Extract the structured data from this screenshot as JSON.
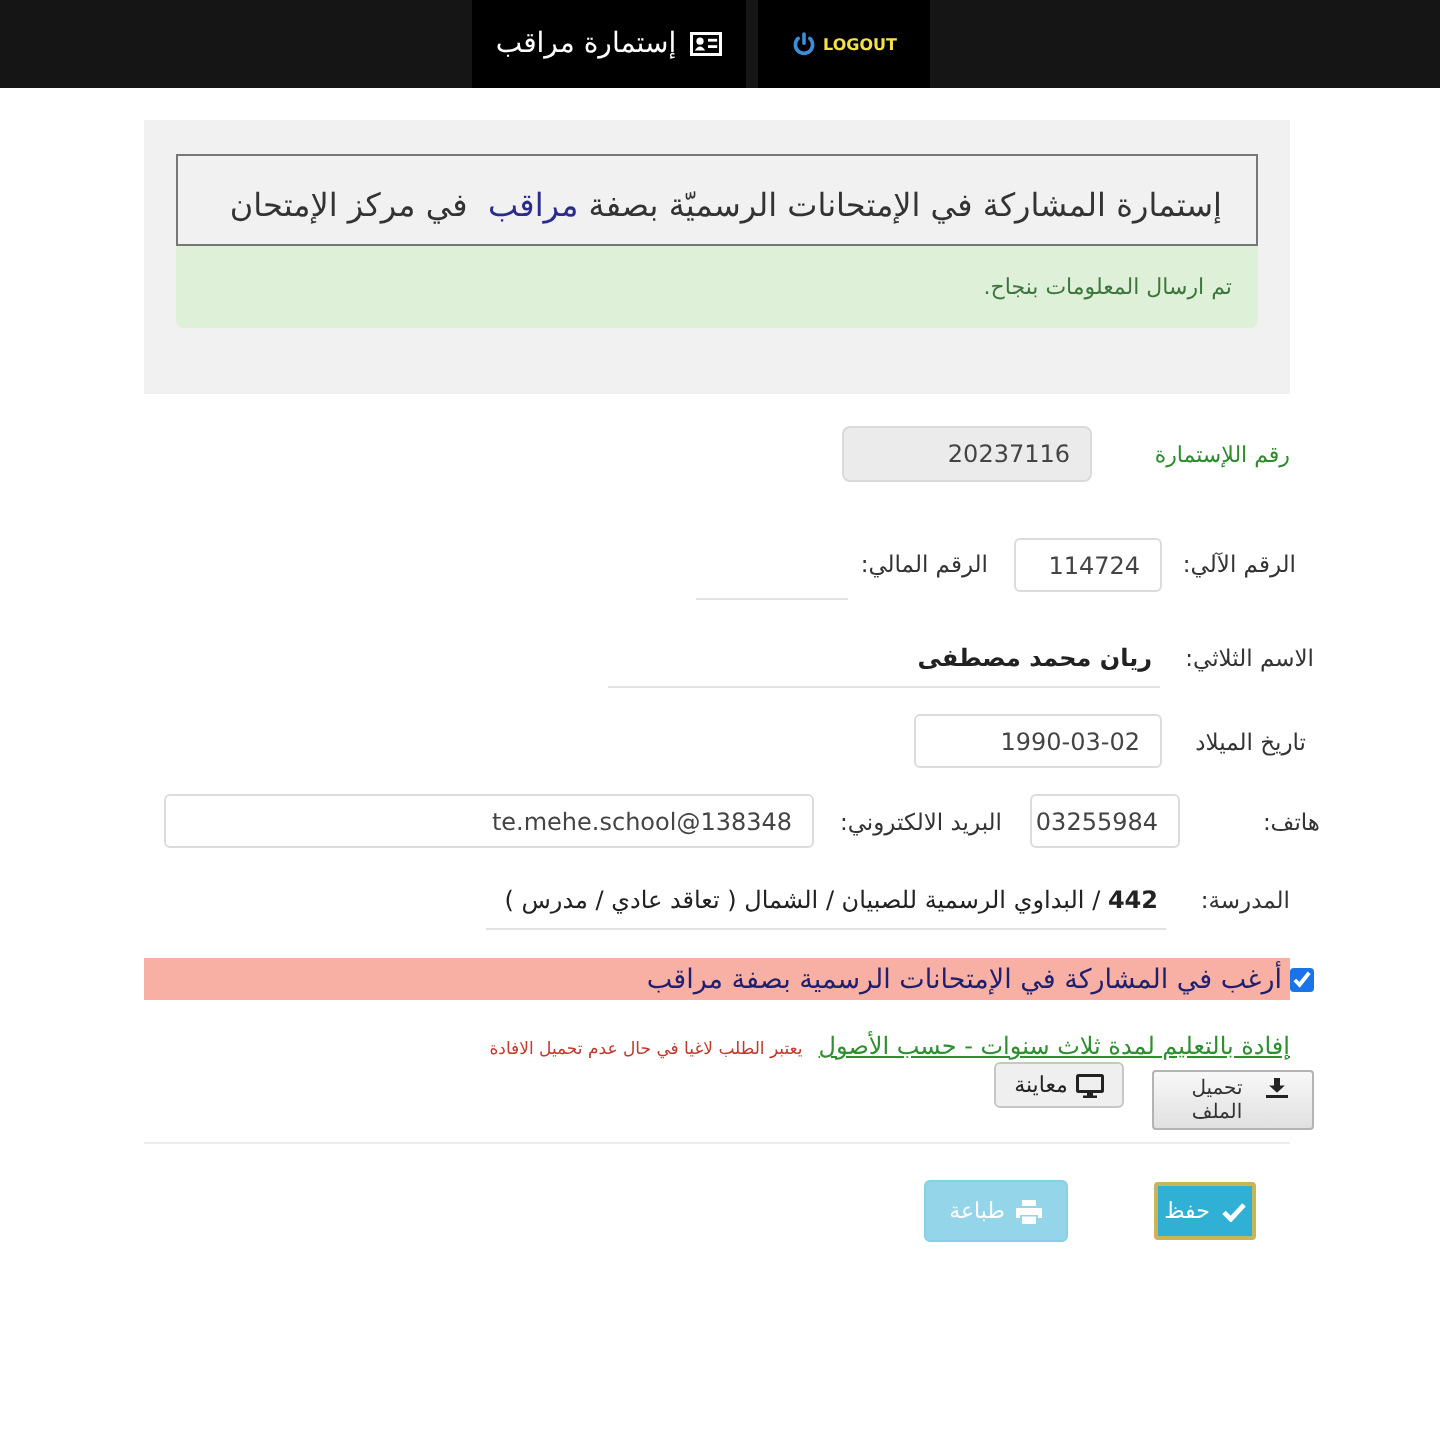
{
  "nav": {
    "tabs": [
      {
        "kind": "logout",
        "label": "LOGOUT"
      },
      {
        "kind": "form",
        "label": "إستمارة مراقب"
      }
    ]
  },
  "header": {
    "title": "إستمارة المشاركة في الإمتحانات الرسميّة بصفة **مراقب**  في مركز الإمتحان",
    "alert": "تم ارسال المعلومات بنجاح."
  },
  "form": {
    "rows": [
      {
        "fields": [
          {
            "kind": "readonly",
            "label": "رقم اللإستمارة",
            "value": "20237116"
          }
        ]
      },
      {
        "fields": [
          {
            "kind": "box",
            "label": "الرقم الآلي:",
            "value": "114724"
          },
          {
            "kind": "line",
            "label": "الرقم المالي:"
          }
        ]
      },
      {
        "fields": [
          {
            "kind": "line",
            "label": "الاسم الثلاثي:",
            "value": "**ريان محمد مصطفى**"
          }
        ]
      },
      {
        "fields": [
          {
            "kind": "box",
            "label": "تاريخ الميلاد",
            "value": "1990-03-02"
          }
        ]
      },
      {
        "fields": [
          {
            "kind": "box",
            "label": "هاتف:",
            "value": "03255984"
          },
          {
            "kind": "box",
            "label": "البريد الالكتروني:",
            "value": "te.mehe.school@138348"
          }
        ]
      },
      {
        "fields": [
          {
            "kind": "line",
            "label": "المدرسة:",
            "value": "**442** / البداوي الرسمية للصبيان / الشمال ( تعاقد عادي / مدرس )"
          }
        ]
      }
    ]
  },
  "agreement": {
    "checked": true,
    "label": "أرغب في المشاركة في الإمتحانات الرسمية بصفة مراقب"
  },
  "attachment": {
    "link": "إفادة بالتعليم لمدة ثلاث سنوات - حسب الأصول",
    "warning": "يعتبر الطلب لاغيا في حال عدم تحميل الافادة",
    "buttons": [
      {
        "kind": "upload",
        "label": "تحميل الملف"
      },
      {
        "kind": "preview",
        "label": "معاينة"
      }
    ]
  },
  "actions": [
    {
      "kind": "save",
      "label": "حفظ",
      "disabled": false
    },
    {
      "kind": "print",
      "label": "طباعة",
      "disabled": true
    }
  ]
}
